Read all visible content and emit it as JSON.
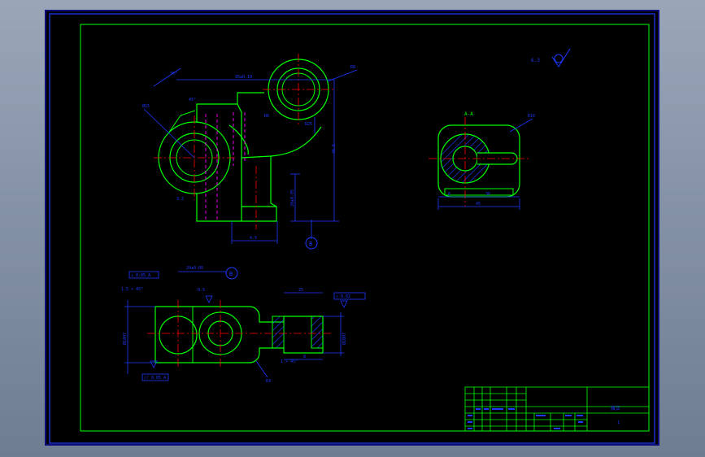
{
  "canvas": {
    "background": "#000000",
    "frame_color": "#00ff00",
    "dim_color": "#1e38ff",
    "outline_color": "#00ff00",
    "center_color": "#ff0000",
    "hidden_color": "#ff00ff",
    "hatch_color": "#1e38ff"
  },
  "front_view": {
    "section_marker": "B",
    "dims": {
      "top_width": "95±0.10",
      "right_height": "46.5",
      "bottom_width": "4.5",
      "vertical_mid": "20±0.05",
      "top_angle": "30°",
      "phi_left": "Ø15",
      "radius_big": "R25",
      "radius_small": "R6",
      "radius_top": "R8",
      "left_label": "3.2",
      "angle_label": "45°"
    }
  },
  "section_view": {
    "title": "A-A",
    "dims": {
      "width_total": "45",
      "width_left": "8",
      "width_right": "30",
      "radius": "R10"
    }
  },
  "roughness_symbol": {
    "value": "6.3"
  },
  "bottom_view": {
    "section_marker": "B",
    "tol_frame_1": "⊥ 0.05 A",
    "tol_frame_2": "// 0.05 A",
    "tol_frame_3": "○ 0.02",
    "chamfer_1": "1.5 × 45°",
    "chamfer_2": "1 × 45°",
    "dim_top": "20±0.05",
    "dim_left": "Ø14H7",
    "dim_right": "Ø10H7",
    "dim_mid": "25",
    "dim_slot": "8",
    "dim_small": "0.5",
    "dim_r": "R3"
  },
  "title_block": {
    "drawing_title": "拨叉",
    "sheet": "1"
  }
}
